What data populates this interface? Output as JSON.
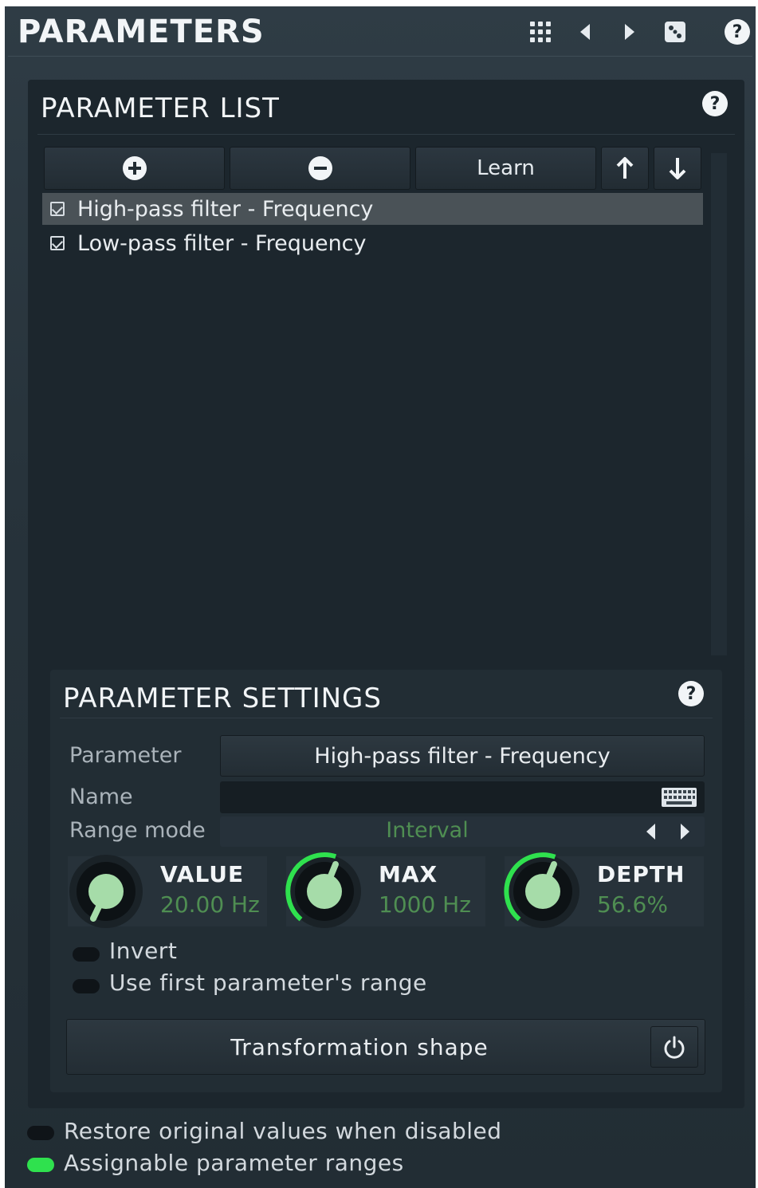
{
  "header": {
    "title": "PARAMETERS",
    "icons": [
      "grid-menu-icon",
      "arrow-left-icon",
      "arrow-right-icon",
      "dice-icon",
      "help-icon"
    ]
  },
  "parameter_list": {
    "title": "PARAMETER LIST",
    "toolbar": {
      "add_icon": "plus-circle-icon",
      "remove_icon": "minus-circle-icon",
      "learn_label": "Learn",
      "up_icon": "arrow-up-icon",
      "down_icon": "arrow-down-icon"
    },
    "items": [
      {
        "label": "High-pass filter - Frequency",
        "checked": true,
        "selected": true
      },
      {
        "label": "Low-pass filter - Frequency",
        "checked": true,
        "selected": false
      }
    ]
  },
  "parameter_settings": {
    "title": "PARAMETER SETTINGS",
    "parameter_label": "Parameter",
    "parameter_value": "High-pass filter - Frequency",
    "name_label": "Name",
    "name_value": "",
    "range_mode_label": "Range mode",
    "range_mode_value": "Interval",
    "knobs": [
      {
        "name": "VALUE",
        "value": "20.00 Hz",
        "level": 0.0
      },
      {
        "name": "MAX",
        "value": "1000 Hz",
        "level": 0.56
      },
      {
        "name": "DEPTH",
        "value": "56.6%",
        "level": 0.566
      }
    ],
    "invert_label": "Invert",
    "invert_on": false,
    "use_first_label": "Use first parameter's range",
    "use_first_on": false,
    "transformation_label": "Transformation shape"
  },
  "footer": {
    "restore_label": "Restore original values when disabled",
    "restore_on": false,
    "assignable_label": "Assignable parameter ranges",
    "assignable_on": true
  },
  "colors": {
    "accent_green": "#2fe14e",
    "knob_value_text": "#4f8e52",
    "knob_fill": "#a6dca9"
  }
}
